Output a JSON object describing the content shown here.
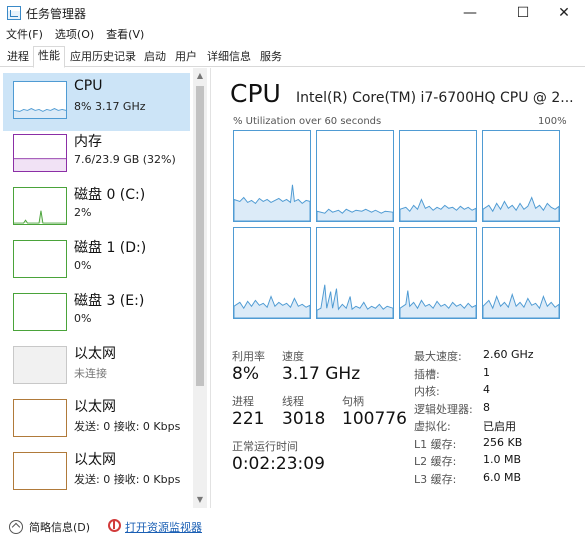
{
  "window": {
    "title": "任务管理器",
    "minimize_icon": "minimize-icon",
    "maximize_icon": "maximize-icon",
    "close_icon": "close-icon",
    "minimize_glyph": "—",
    "maximize_glyph": "☐",
    "close_glyph": "✕"
  },
  "menu": [
    "文件(F)",
    "选项(O)",
    "查看(V)"
  ],
  "tabs": [
    "进程",
    "性能",
    "应用历史记录",
    "启动",
    "用户",
    "详细信息",
    "服务"
  ],
  "active_tab": "性能",
  "sidebar": {
    "items": [
      {
        "title": "CPU",
        "subtitle": "8% 3.17 GHz",
        "color": "#4f9bd3",
        "selected": true,
        "icon": "cpu-thumbnail"
      },
      {
        "title": "内存",
        "subtitle": "7.6/23.9 GB (32%)",
        "color": "#8b2fa6",
        "selected": false,
        "icon": "memory-thumbnail"
      },
      {
        "title": "磁盘 0 (C:)",
        "subtitle": "2%",
        "color": "#4aa33a",
        "selected": false,
        "icon": "disk-thumbnail"
      },
      {
        "title": "磁盘 1 (D:)",
        "subtitle": "0%",
        "color": "#4aa33a",
        "selected": false,
        "icon": "disk-thumbnail"
      },
      {
        "title": "磁盘 3 (E:)",
        "subtitle": "0%",
        "color": "#4aa33a",
        "selected": false,
        "icon": "disk-thumbnail"
      },
      {
        "title": "以太网",
        "subtitle": "未连接",
        "color": "#c8c8c8",
        "selected": false,
        "icon": "ethernet-thumbnail"
      },
      {
        "title": "以太网",
        "subtitle": "发送: 0 接收: 0 Kbps",
        "color": "#b07a3a",
        "selected": false,
        "icon": "ethernet-thumbnail"
      },
      {
        "title": "以太网",
        "subtitle": "发送: 0 接收: 0 Kbps",
        "color": "#b07a3a",
        "selected": false,
        "icon": "ethernet-thumbnail"
      }
    ]
  },
  "cpu": {
    "heading": "CPU",
    "model": "Intel(R) Core(TM) i7-6700HQ CPU @ 2...",
    "util_label": "% Utilization over 60 seconds",
    "util_max": "100%",
    "graph_color": "#4f9bd3"
  },
  "stats": {
    "utilization_label": "利用率",
    "utilization_value": "8%",
    "speed_label": "速度",
    "speed_value": "3.17 GHz",
    "processes_label": "进程",
    "processes_value": "221",
    "threads_label": "线程",
    "threads_value": "3018",
    "handles_label": "句柄",
    "handles_value": "100776",
    "uptime_label": "正常运行时间",
    "uptime_value": "0:02:23:09"
  },
  "info": [
    {
      "label": "最大速度:",
      "value": "2.60 GHz"
    },
    {
      "label": "插槽:",
      "value": "1"
    },
    {
      "label": "内核:",
      "value": "4"
    },
    {
      "label": "逻辑处理器:",
      "value": "8"
    },
    {
      "label": "虚拟化:",
      "value": "已启用"
    },
    {
      "label": "L1 缓存:",
      "value": "256 KB"
    },
    {
      "label": "L2 缓存:",
      "value": "1.0 MB"
    },
    {
      "label": "L3 缓存:",
      "value": "6.0 MB"
    }
  ],
  "footer": {
    "less_details": "简略信息(D)",
    "open_resource_monitor": "打开资源监视器"
  }
}
